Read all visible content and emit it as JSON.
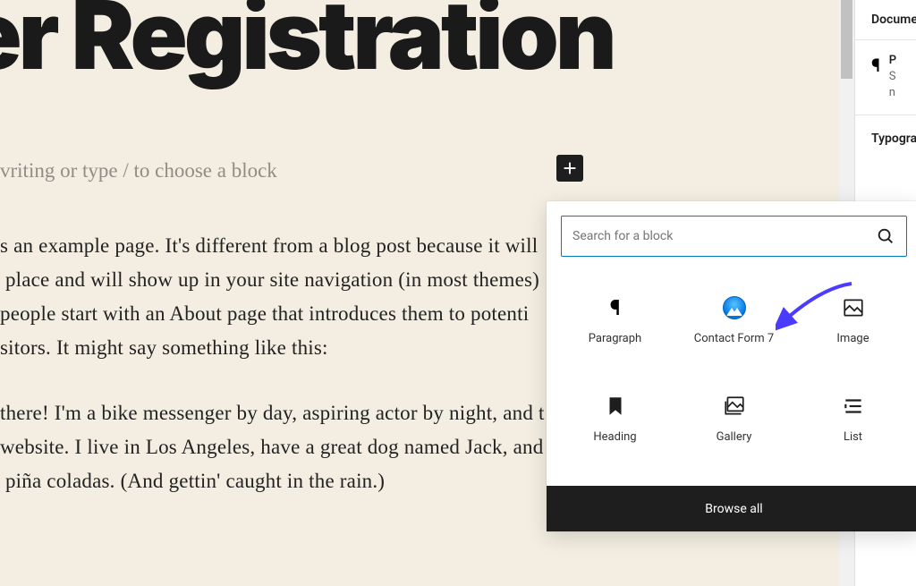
{
  "page": {
    "title": "ser Registration",
    "placeholder_prompt": "vriting or type / to choose a block",
    "paragraph1": "s an example page. It's different from a blog post because it will\n place and will show up in your site navigation (in most themes)\npeople start with an About page that introduces them to potenti\nsitors. It might say something like this:",
    "paragraph2": "there! I'm a bike messenger by day, aspiring actor by night, and t\nwebsite. I live in Los Angeles, have a great dog named Jack, and\n piña coladas. (And gettin' caught in the rain.)"
  },
  "inserter": {
    "search_placeholder": "Search for a block",
    "blocks": {
      "paragraph": "Paragraph",
      "contact_form_7": "Contact Form 7",
      "image": "Image",
      "heading": "Heading",
      "gallery": "Gallery",
      "list": "List"
    },
    "browse_all": "Browse all"
  },
  "sidebar": {
    "tab": "Docume",
    "block_title": "P",
    "block_desc_line1": "S",
    "block_desc_line2": "n",
    "typography": "Typogra"
  }
}
